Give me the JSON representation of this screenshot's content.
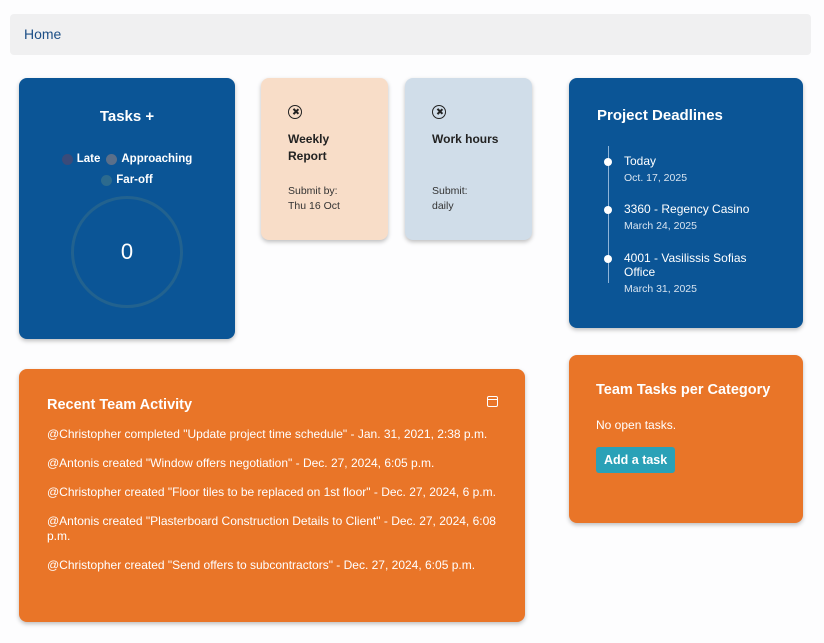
{
  "breadcrumb": {
    "home": "Home"
  },
  "tasks": {
    "title": "Tasks",
    "plus": "+",
    "legend": [
      {
        "label": "Late",
        "color": "#3a4b7a"
      },
      {
        "label": "Approaching",
        "color": "#5a6f8a"
      },
      {
        "label": "Far-off",
        "color": "#2c6a8e"
      }
    ],
    "count": "0"
  },
  "weekly_report": {
    "icon": "close-circle-icon",
    "name": "Weekly Report",
    "sub_label": "Submit by:",
    "sub_value": "Thu 16 Oct",
    "color": "#f8ddc8"
  },
  "work_hours": {
    "icon": "close-circle-icon",
    "name": "Work hours",
    "sub_label": "Submit:",
    "sub_value": "daily",
    "color": "#d0dde9"
  },
  "deadlines": {
    "title": "Project Deadlines",
    "items": [
      {
        "title": "Today",
        "date": "Oct. 17, 2025"
      },
      {
        "title": "3360 - Regency Casino",
        "date": "March 24, 2025"
      },
      {
        "title": "4001 - Vasilissis Sofias Office",
        "date": "March 31, 2025"
      }
    ]
  },
  "activity": {
    "title": "Recent Team Activity",
    "icon": "calendar-icon",
    "items": [
      "@Christopher completed \"Update project time schedule\" - Jan. 31, 2021, 2:38 p.m.",
      "@Antonis created \"Window offers negotiation\" - Dec. 27, 2024, 6:05 p.m.",
      "@Christopher created \"Floor tiles to be replaced on 1st floor\" - Dec. 27, 2024, 6 p.m.",
      "@Antonis created \"Plasterboard Construction Details to Client\" - Dec. 27, 2024, 6:08 p.m.",
      "@Christopher created \"Send offers to subcontractors\" - Dec. 27, 2024, 6:05 p.m."
    ]
  },
  "team_tasks": {
    "title": "Team Tasks per Category",
    "empty": "No open tasks.",
    "button": "Add a task"
  },
  "colors": {
    "blue": "#0b5596",
    "orange": "#e97528",
    "button": "#2aa1b7"
  }
}
